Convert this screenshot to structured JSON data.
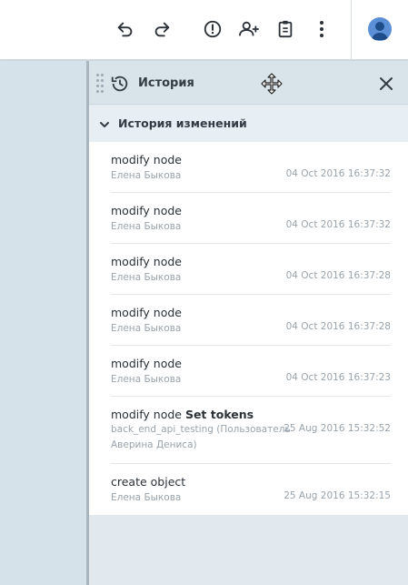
{
  "toolbar": {
    "icons": [
      "undo-icon",
      "redo-icon",
      "alert-icon",
      "add-user-icon",
      "clipboard-icon",
      "more-vertical-icon"
    ],
    "avatar_icon": "user-avatar-icon"
  },
  "panel": {
    "title": "История",
    "section_title": "История изменений",
    "accent_color": "#5b8fd6"
  },
  "history": [
    {
      "action": "modify node",
      "action_extra": "",
      "user": "Елена Быкова",
      "date": "04 Oct 2016 16:37:32"
    },
    {
      "action": "modify node",
      "action_extra": "",
      "user": "Елена Быкова",
      "date": "04 Oct 2016 16:37:32"
    },
    {
      "action": "modify node",
      "action_extra": "",
      "user": "Елена Быкова",
      "date": "04 Oct 2016 16:37:28"
    },
    {
      "action": "modify node",
      "action_extra": "",
      "user": "Елена Быкова",
      "date": "04 Oct 2016 16:37:28"
    },
    {
      "action": "modify node",
      "action_extra": "",
      "user": "Елена Быкова",
      "date": "04 Oct 2016 16:37:23"
    },
    {
      "action": "modify node ",
      "action_extra": "Set tokens",
      "user_line1": "back_end_api_testing (Пользователь",
      "user_line2": "Аверина Дениса)",
      "date": "25 Aug 2016 15:32:52"
    },
    {
      "action": "create object",
      "action_extra": "",
      "user": "Елена Быкова",
      "date": "25 Aug 2016 15:32:15"
    }
  ]
}
